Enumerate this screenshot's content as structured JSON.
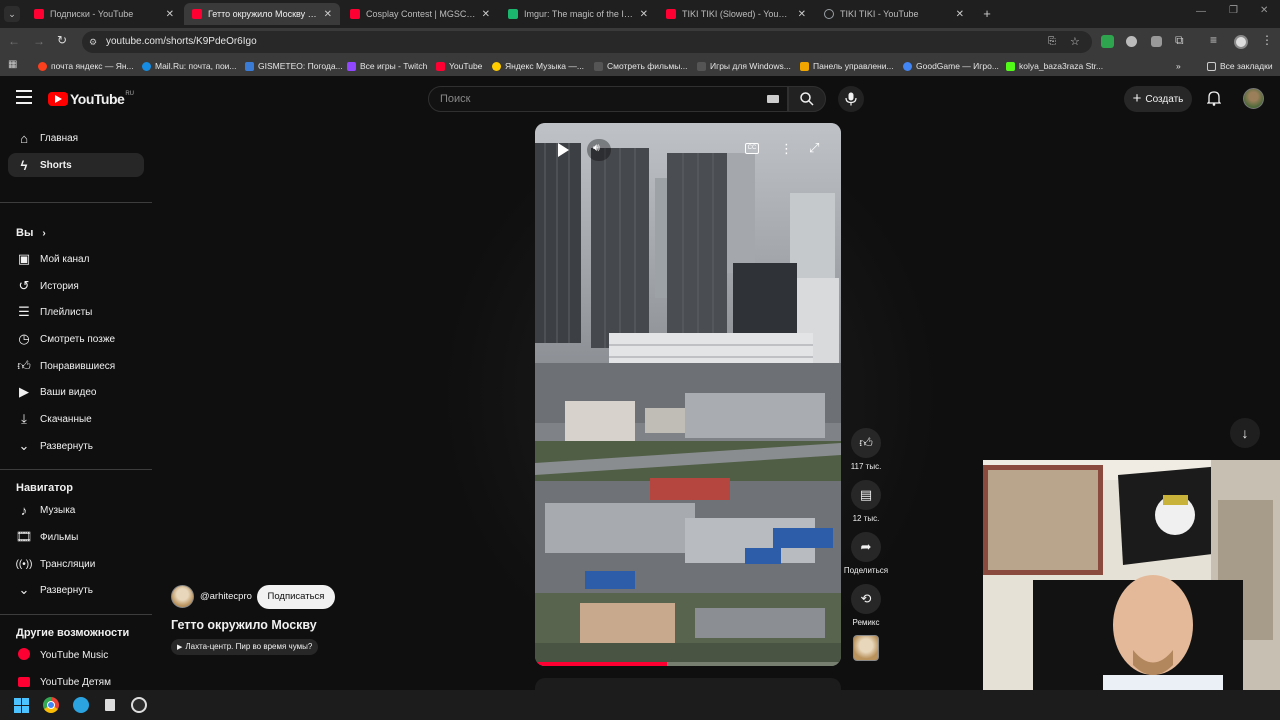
{
  "browser": {
    "tabs": [
      {
        "title": "Подписки - YouTube",
        "color": "#ff0033"
      },
      {
        "title": "Гетто окружило Москву - YouTube",
        "color": "#ff0033"
      },
      {
        "title": "Cosplay Contest | MGSCON 2024",
        "color": "#ff0033"
      },
      {
        "title": "Imgur: The magic of the Internet",
        "color": "#1bb76e"
      },
      {
        "title": "TIKI TIKI (Slowed) - YouTube",
        "color": "#ff0033"
      },
      {
        "title": "TIKI TIKI - YouTube",
        "color": "#9aa0a6"
      }
    ],
    "url": "youtube.com/shorts/K9PdeOr6Igo",
    "bookmarks": [
      {
        "label": "почта яндекс — Ян...",
        "color": "#fc3f1d"
      },
      {
        "label": "Mail.Ru: почта, пои...",
        "color": "#168de2"
      },
      {
        "label": "GISMETEO: Погода...",
        "color": "#3a7bd5"
      },
      {
        "label": "Все игры - Twitch",
        "color": "#9146ff"
      },
      {
        "label": "YouTube",
        "color": "#ff0033"
      },
      {
        "label": "Яндекс Музыка —...",
        "color": "#ffcc00"
      },
      {
        "label": "Смотреть фильмы...",
        "color": "#555555"
      },
      {
        "label": "Игры для Windows...",
        "color": "#555555"
      },
      {
        "label": "Панель управлени...",
        "color": "#f0a500"
      },
      {
        "label": "GoodGame — Игро...",
        "color": "#4285f4"
      },
      {
        "label": "kolya_baza3raza Str...",
        "color": "#53fc18"
      }
    ],
    "all_bookmarks": "Все закладки"
  },
  "youtube": {
    "logo_text": "YouTube",
    "logo_region": "RU",
    "search_placeholder": "Поиск",
    "create_label": "Создать",
    "sidebar": {
      "top": [
        {
          "label": "Главная",
          "icon": "home-icon"
        },
        {
          "label": "Shorts",
          "icon": "shorts-icon"
        }
      ],
      "you_header": "Вы",
      "you": [
        {
          "label": "Мой канал",
          "icon": "channel-icon"
        },
        {
          "label": "История",
          "icon": "history-icon"
        },
        {
          "label": "Плейлисты",
          "icon": "playlists-icon"
        },
        {
          "label": "Смотреть позже",
          "icon": "clock-icon"
        },
        {
          "label": "Понравившиеся",
          "icon": "like-icon"
        },
        {
          "label": "Ваши видео",
          "icon": "video-icon"
        },
        {
          "label": "Скачанные",
          "icon": "download-icon"
        },
        {
          "label": "Развернуть",
          "icon": "chevron-down-icon"
        }
      ],
      "nav_header": "Навигатор",
      "nav": [
        {
          "label": "Музыка",
          "icon": "music-icon"
        },
        {
          "label": "Фильмы",
          "icon": "film-icon"
        },
        {
          "label": "Трансляции",
          "icon": "live-icon"
        },
        {
          "label": "Развернуть",
          "icon": "chevron-down-icon"
        }
      ],
      "more_header": "Другие возможности",
      "more": [
        {
          "label": "YouTube Music",
          "icon": "yt-music-icon"
        },
        {
          "label": "YouTube Детям",
          "icon": "yt-kids-icon"
        }
      ]
    },
    "short": {
      "channel": "@arhitecpro",
      "subscribe": "Подписаться",
      "title": "Гетто окружило Москву",
      "music": "Лахта-центр. Пир во время чумы?",
      "likes": "117 тыс.",
      "comments": "12 тыс.",
      "share": "Поделиться",
      "remix": "Ремикс",
      "progress": 0.43
    }
  }
}
